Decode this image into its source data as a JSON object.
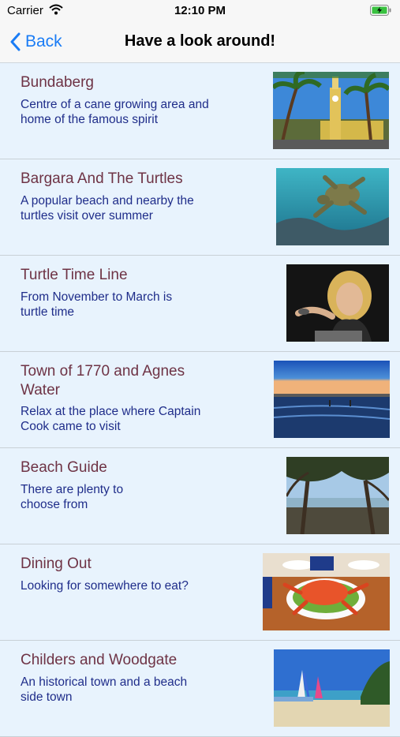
{
  "status": {
    "carrier": "Carrier",
    "time": "12:10 PM"
  },
  "nav": {
    "back_label": "Back",
    "title": "Have a look around!"
  },
  "items": [
    {
      "title": "Bundaberg",
      "subtitle": "Centre of a cane growing area and home of the famous spirit",
      "image": "clock-tower-palms-photo"
    },
    {
      "title": "Bargara And The Turtles",
      "subtitle": "A popular beach and nearby the turtles visit over summer",
      "image": "sea-turtle-photo"
    },
    {
      "title": "Turtle Time Line",
      "subtitle": "From November to March is turtle time",
      "image": "woman-with-hatchling-photo"
    },
    {
      "title": "Town of 1770 and Agnes Water",
      "subtitle": "Relax at the place where Captain Cook came to visit",
      "image": "beach-sunset-photo"
    },
    {
      "title": "Beach Guide",
      "subtitle": "There are plenty to choose from",
      "image": "beach-trees-photo"
    },
    {
      "title": "Dining Out",
      "subtitle": "Looking for somewhere to eat?",
      "image": "crab-dinner-photo"
    },
    {
      "title": "Childers and Woodgate",
      "subtitle": "An historical town and a beach side town",
      "image": "windsurf-beach-photo"
    }
  ]
}
